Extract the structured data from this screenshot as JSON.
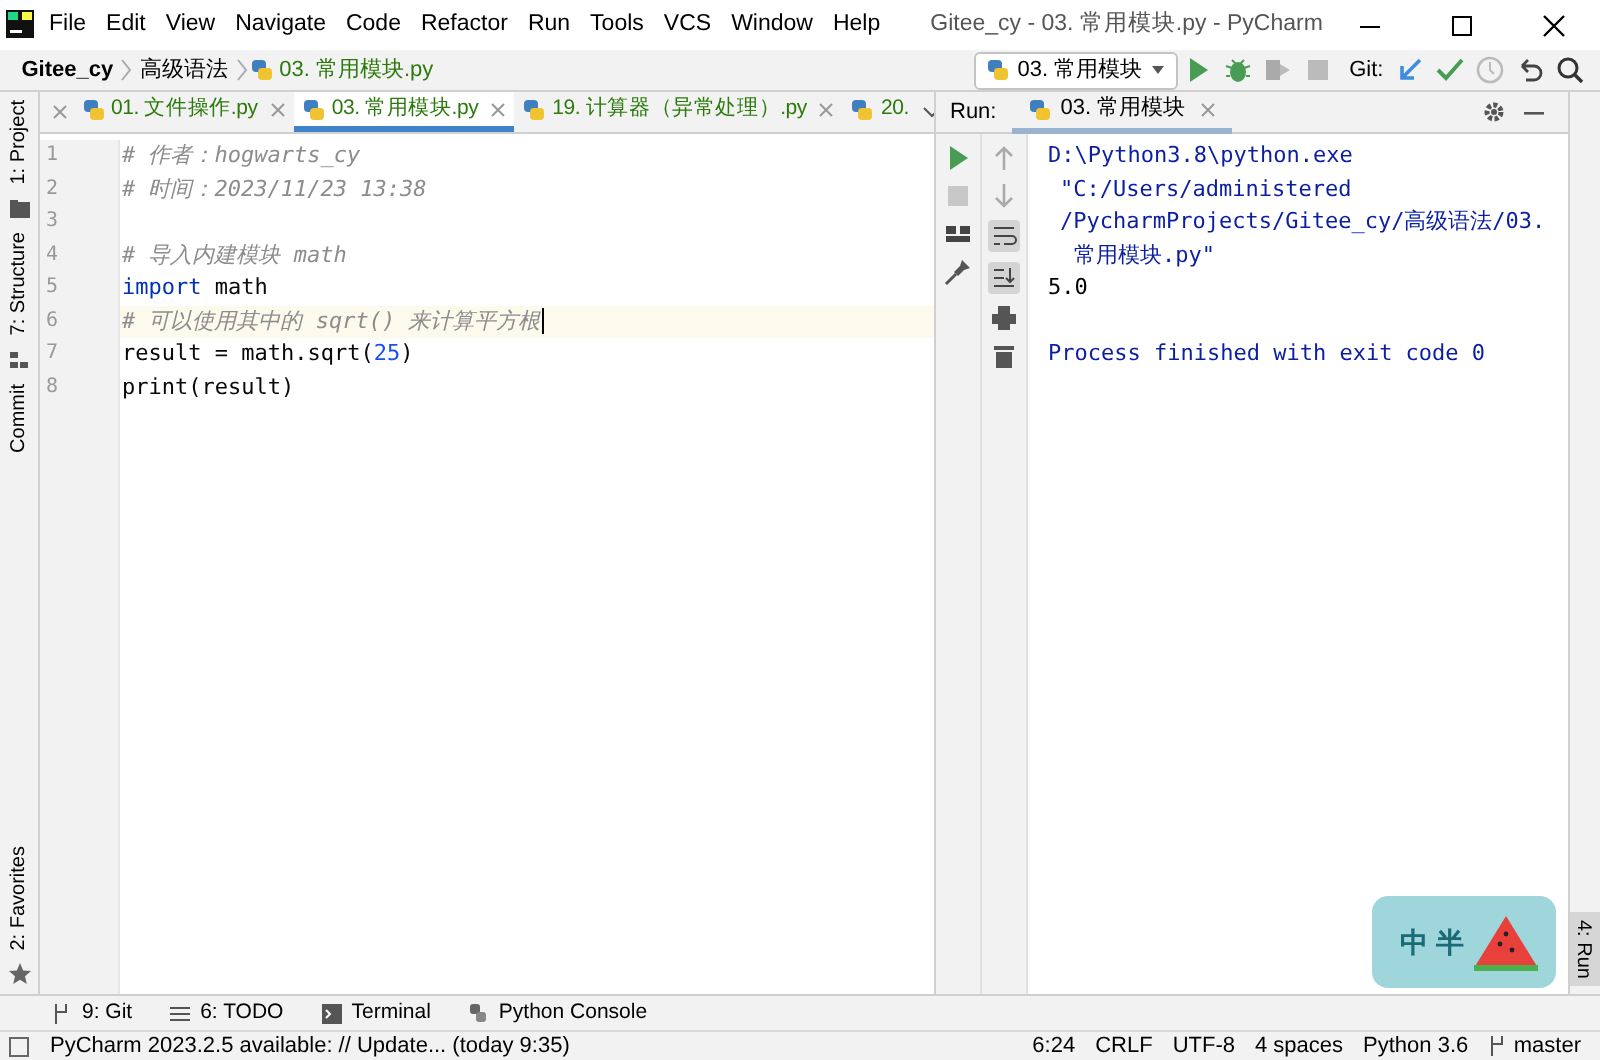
{
  "window": {
    "title": "Gitee_cy - 03. 常用模块.py - PyCharm"
  },
  "menu": [
    "File",
    "Edit",
    "View",
    "Navigate",
    "Code",
    "Refactor",
    "Run",
    "Tools",
    "VCS",
    "Window",
    "Help"
  ],
  "breadcrumb": [
    "Gitee_cy",
    "高级语法",
    "03. 常用模块.py"
  ],
  "toolbar": {
    "run_config": "03. 常用模块",
    "git_label": "Git:"
  },
  "left_stripe": [
    {
      "label": "1: Project",
      "kind": "top"
    },
    {
      "label": "7: Structure",
      "kind": "top"
    },
    {
      "label": "Commit",
      "kind": "top"
    },
    {
      "label": "2: Favorites",
      "kind": "bottom"
    }
  ],
  "editor_tabs": [
    {
      "label": "01. 文件操作.py",
      "selected": false
    },
    {
      "label": "03. 常用模块.py",
      "selected": true
    },
    {
      "label": "19. 计算器（异常处理）.py",
      "selected": false
    },
    {
      "label": "20.",
      "selected": false
    }
  ],
  "code": {
    "lines": [
      {
        "number": "1",
        "current": false,
        "tokens": [
          {
            "kind": "comment",
            "text": "# 作者：hogwarts_cy"
          }
        ]
      },
      {
        "number": "2",
        "current": false,
        "tokens": [
          {
            "kind": "comment",
            "text": "# 时间：2023/11/23 13:38"
          }
        ]
      },
      {
        "number": "3",
        "current": false
      },
      {
        "number": "4",
        "current": false,
        "tokens": [
          {
            "kind": "comment",
            "text": "# 导入内建模块 math"
          }
        ]
      },
      {
        "number": "5",
        "current": false,
        "tokens": [
          {
            "kind": "keyword",
            "text": "import"
          },
          {
            "kind": "plain",
            "text": " math"
          }
        ]
      },
      {
        "number": "6",
        "current": true,
        "tokens": [
          {
            "kind": "comment",
            "text": "# 可以使用其中的 sqrt() 来计算平方根"
          }
        ]
      },
      {
        "number": "7",
        "current": false,
        "tokens": [
          {
            "kind": "plain",
            "text": "result = math.sqrt("
          },
          {
            "kind": "number",
            "text": "25"
          },
          {
            "kind": "plain",
            "text": ")"
          }
        ]
      },
      {
        "number": "8",
        "current": false,
        "tokens": [
          {
            "kind": "plain",
            "text": "print(result)"
          }
        ]
      }
    ]
  },
  "run": {
    "label": "Run:",
    "tab": "03. 常用模块",
    "output": [
      {
        "kind": "command",
        "text": "D:\\Python3.8\\python.exe"
      },
      {
        "kind": "wrap",
        "text": "\"C:/Users/administered"
      },
      {
        "kind": "wrap",
        "text": "/PycharmProjects/Gitee_cy/高级语法/03."
      },
      {
        "kind": "wrap2",
        "text": "常用模块.py\""
      },
      {
        "kind": "stdout",
        "text": "5.0"
      },
      {
        "kind": "exit",
        "text": "Process finished with exit code 0"
      }
    ]
  },
  "right_stripe": {
    "label": "4: Run"
  },
  "tool_windows": [
    {
      "label": "9: Git",
      "kind": "git"
    },
    {
      "label": "6: TODO",
      "kind": "todo"
    },
    {
      "label": "Terminal",
      "kind": "terminal"
    },
    {
      "label": "Python Console",
      "kind": "console"
    }
  ],
  "status_bar": {
    "message": "PyCharm 2023.2.5 available: // Update... (today 9:35)",
    "items": [
      "6:24",
      "CRLF",
      "UTF-8",
      "4 spaces",
      "Python 3.6"
    ],
    "branch": "master"
  },
  "ime": {
    "mode": "中",
    "width": "半"
  }
}
